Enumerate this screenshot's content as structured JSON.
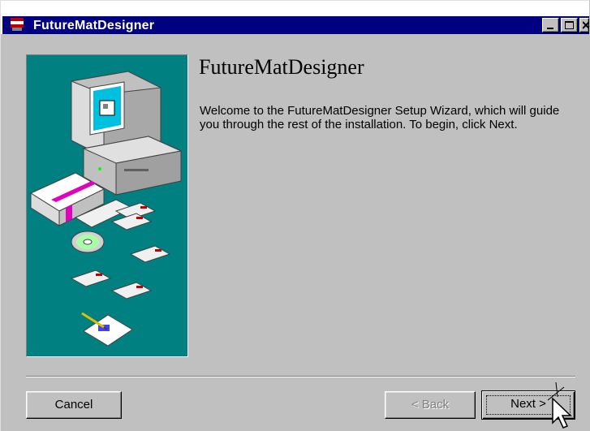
{
  "window": {
    "title": "FutureMatDesigner",
    "controls": [
      "minimize-icon",
      "maximize-icon",
      "close-icon"
    ]
  },
  "main": {
    "heading": "FutureMatDesigner",
    "welcome_text": "Welcome to the FutureMatDesigner Setup Wizard, which will guide you through the rest of the installation. To begin, click Next."
  },
  "buttons": {
    "cancel": "Cancel",
    "back": "< Back",
    "next": "Next >"
  },
  "colors": {
    "titlebar": "#000080",
    "panel": "#008080",
    "face": "#c0c0c0"
  }
}
